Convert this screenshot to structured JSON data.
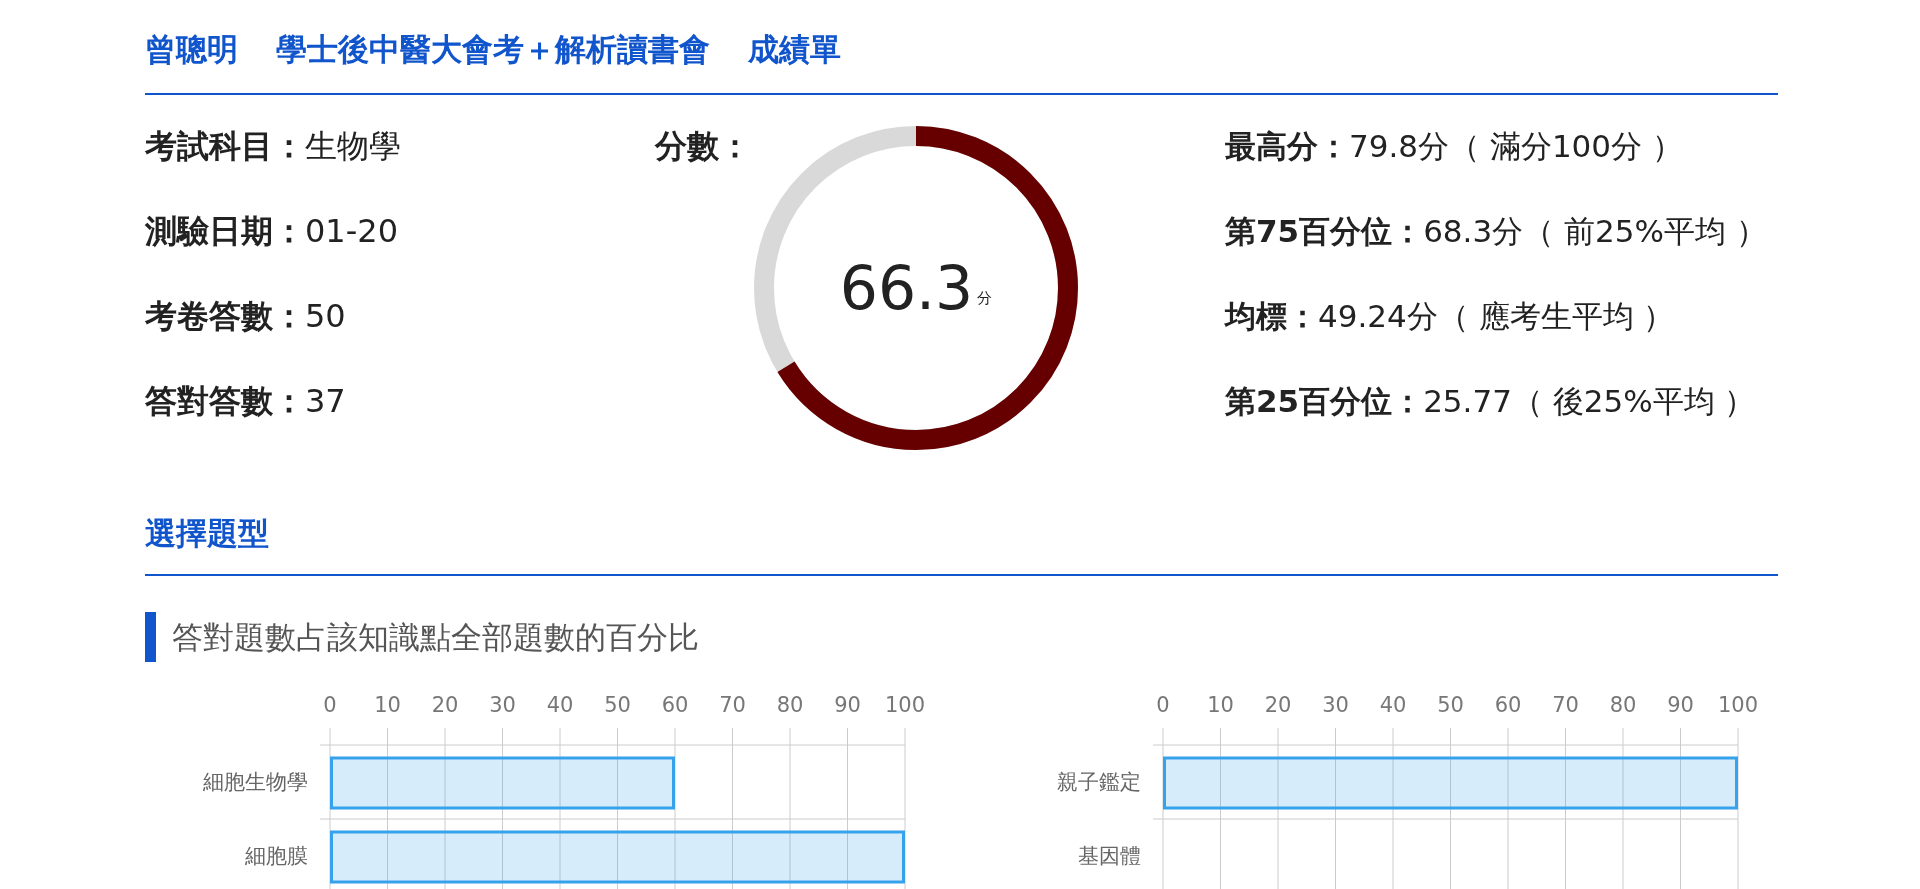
{
  "header": {
    "title_parts": [
      "曾聰明",
      "學士後中醫大會考＋解析讀書會",
      "成績單"
    ]
  },
  "info": [
    {
      "label": "考試科目：",
      "value": "生物學"
    },
    {
      "label": "測驗日期：",
      "value": "01-20"
    },
    {
      "label": "考卷答數：",
      "value": "50"
    },
    {
      "label": "答對答數：",
      "value": "37"
    }
  ],
  "score": {
    "label": "分數：",
    "value": "66.3",
    "unit": "分",
    "level": 0.663
  },
  "stats": [
    {
      "label": "最高分：",
      "value": "79.8分（ 滿分100分 ）"
    },
    {
      "label": "第75百分位：",
      "value": "68.3分（ 前25%平均 ）"
    },
    {
      "label": "均標：",
      "value": "49.24分（ 應考生平均 ）"
    },
    {
      "label": "第25百分位：",
      "value": "25.77（ 後25%平均 ）"
    }
  ],
  "section": {
    "title": "選擇題型",
    "subtitle": "答對題數占該知識點全部題數的百分比"
  },
  "charts": [
    {
      "chart_data": {
        "type": "bar",
        "orientation": "horizontal",
        "grid": true,
        "categories": [
          "細胞生物學",
          "細胞膜"
        ],
        "values": [
          60,
          100
        ],
        "xlim": [
          0,
          100
        ],
        "xticks": [
          0,
          10,
          20,
          30,
          40,
          50,
          60,
          70,
          80,
          90,
          100
        ]
      }
    },
    {
      "chart_data": {
        "type": "bar",
        "orientation": "horizontal",
        "grid": true,
        "categories": [
          "親子鑑定",
          "基因體"
        ],
        "values": [
          100,
          0
        ],
        "xlim": [
          0,
          100
        ],
        "xticks": [
          0,
          10,
          20,
          30,
          40,
          50,
          60,
          70,
          80,
          90,
          100
        ]
      }
    }
  ]
}
